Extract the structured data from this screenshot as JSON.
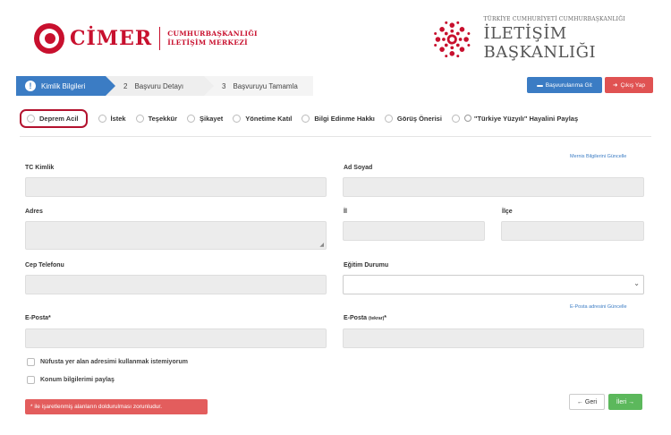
{
  "header": {
    "cimer_name": "CİMER",
    "cimer_sub_line1": "CUMHURBAŞKANLIĞI",
    "cimer_sub_line2": "İLETİŞİM MERKEZİ",
    "ib_top": "TÜRKİYE CUMHURİYETİ CUMHURBAŞKANLIĞI",
    "ib_main": "İLETİŞİM BAŞKANLIĞI"
  },
  "steps": [
    {
      "number": "",
      "label": "Kimlik Bilgileri"
    },
    {
      "number": "2",
      "label": "Başvuru Detayı"
    },
    {
      "number": "3",
      "label": "Başvuruyu Tamamla"
    }
  ],
  "actions": {
    "basvuru": "Başvurularıma Git",
    "cikis": "Çıkış Yap"
  },
  "types": [
    "Deprem Acil",
    "İstek",
    "Teşekkür",
    "Şikayet",
    "Yönetime Katıl",
    "Bilgi Edinme Hakkı",
    "Görüş Önerisi",
    "\"Türkiye Yüzyılı\" Hayalini Paylaş"
  ],
  "form": {
    "tc_label": "TC Kimlik",
    "adsoyad_label": "Ad Soyad",
    "update_name_link": "Mernis Bilgilerini Güncelle",
    "adres_label": "Adres",
    "il_label": "İl",
    "ilce_label": "İlçe",
    "cep_label": "Cep Telefonu",
    "egitim_label": "Eğitim Durumu",
    "update_email_link": "E-Posta adresini Güncelle",
    "eposta_label": "E-Posta*",
    "eposta2_label": "E-Posta",
    "eposta2_small": "(tekrar)",
    "eposta2_star": "*",
    "check1": "Nüfusta yer alan adresimi kullanmak istemiyorum",
    "check2": "Konum bilgilerimi paylaş",
    "required_note": "* ile işaretlenmiş alanların doldurulması zorunludur.",
    "geri": "Geri",
    "ileri": "İleri"
  },
  "colors": {
    "accent": "#3b7cc4",
    "brand_red": "#c8102e",
    "danger": "#e05252",
    "success": "#5cb85c"
  }
}
